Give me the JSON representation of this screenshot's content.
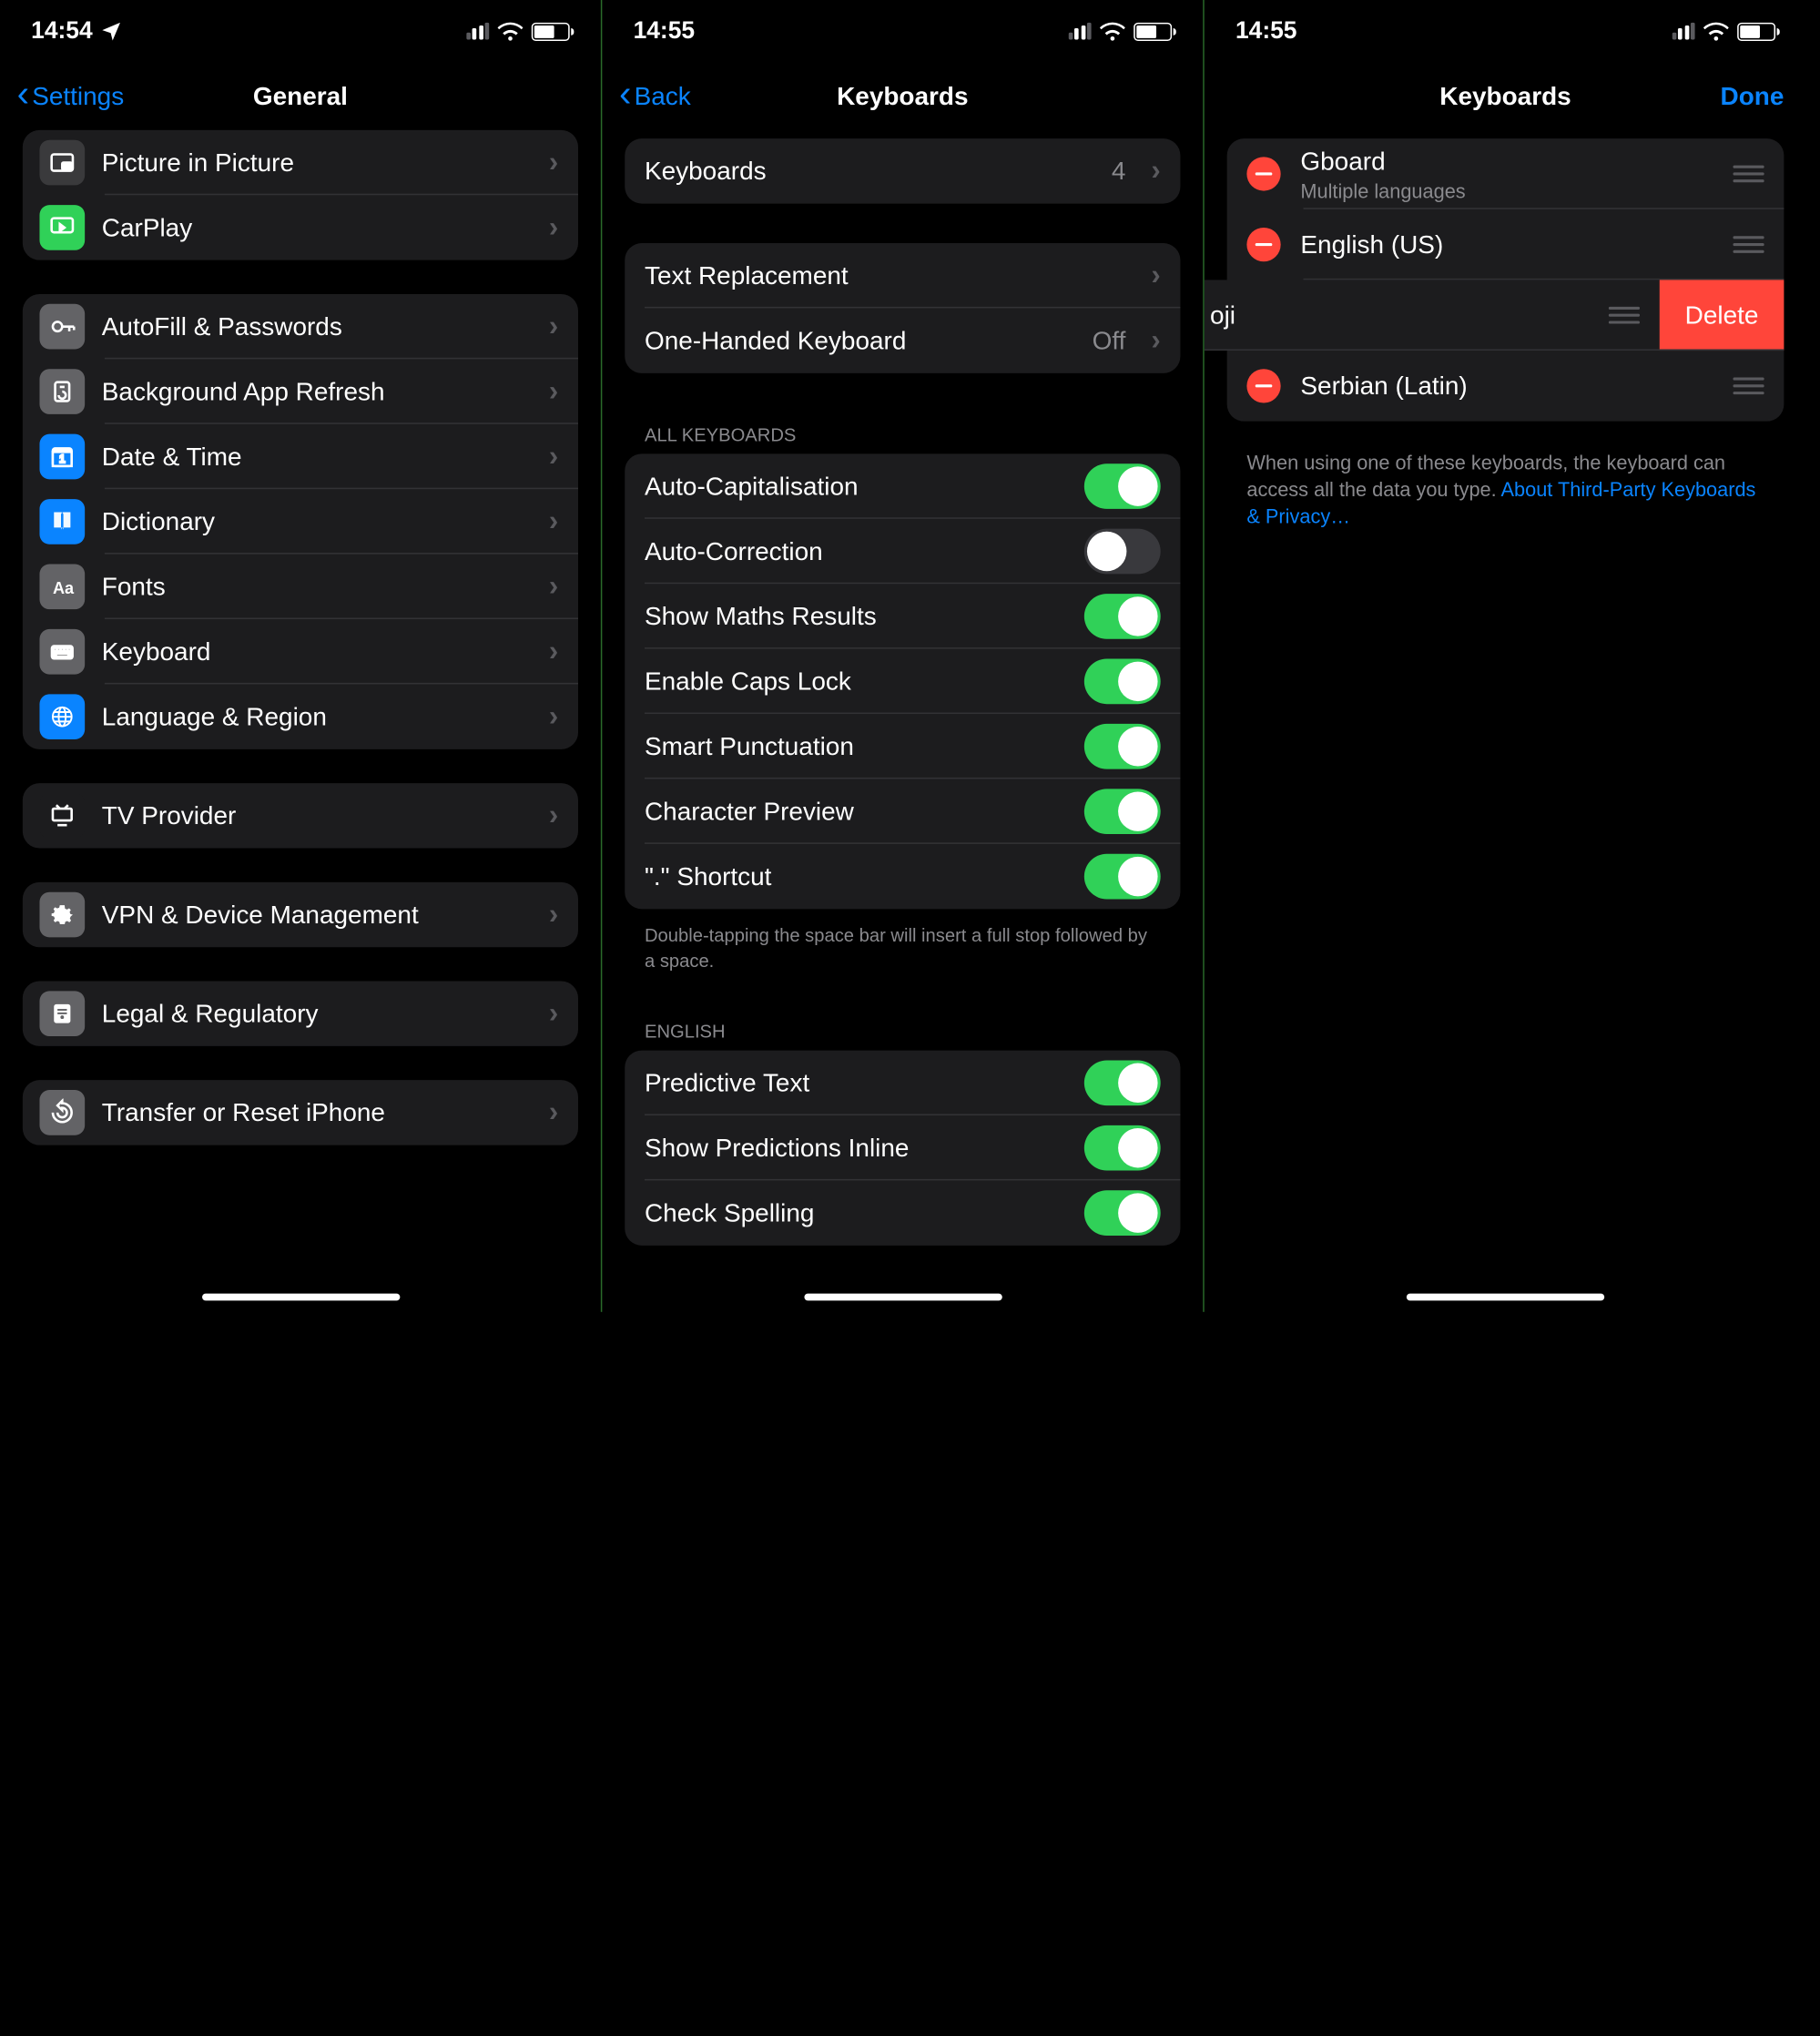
{
  "screen1": {
    "time": "14:54",
    "back": "Settings",
    "title": "General",
    "groups": [
      {
        "items": [
          {
            "id": "pip",
            "icon": "pip",
            "bg": "#3a3a3c",
            "label": "Picture in Picture"
          },
          {
            "id": "carplay",
            "icon": "carplay",
            "bg": "#30d158",
            "label": "CarPlay"
          }
        ]
      },
      {
        "items": [
          {
            "id": "autofill",
            "icon": "key",
            "bg": "#636366",
            "label": "AutoFill & Passwords"
          },
          {
            "id": "refresh",
            "icon": "refresh",
            "bg": "#636366",
            "label": "Background App Refresh"
          },
          {
            "id": "date",
            "icon": "calendar",
            "bg": "#0a84ff",
            "label": "Date & Time"
          },
          {
            "id": "dict",
            "icon": "book",
            "bg": "#0a84ff",
            "label": "Dictionary"
          },
          {
            "id": "fonts",
            "icon": "fonts",
            "bg": "#636366",
            "label": "Fonts"
          },
          {
            "id": "keyboard",
            "icon": "keyboard",
            "bg": "#636366",
            "label": "Keyboard"
          },
          {
            "id": "lang",
            "icon": "globe",
            "bg": "#0a84ff",
            "label": "Language & Region"
          }
        ]
      },
      {
        "items": [
          {
            "id": "tv",
            "icon": "tv",
            "bg": "#1c1c1e",
            "label": "TV Provider"
          }
        ]
      },
      {
        "items": [
          {
            "id": "vpn",
            "icon": "gear",
            "bg": "#636366",
            "label": "VPN & Device Management"
          }
        ]
      },
      {
        "items": [
          {
            "id": "legal",
            "icon": "cert",
            "bg": "#636366",
            "label": "Legal & Regulatory"
          }
        ]
      },
      {
        "items": [
          {
            "id": "transfer",
            "icon": "reset",
            "bg": "#636366",
            "label": "Transfer or Reset iPhone"
          }
        ]
      }
    ]
  },
  "screen2": {
    "time": "14:55",
    "back": "Back",
    "title": "Keyboards",
    "kb_row": {
      "label": "Keyboards",
      "value": "4"
    },
    "text_repl": "Text Replacement",
    "one_hand": {
      "label": "One-Handed Keyboard",
      "value": "Off"
    },
    "all_kb_header": "ALL KEYBOARDS",
    "toggles1": [
      {
        "label": "Auto-Capitalisation",
        "on": true
      },
      {
        "label": "Auto-Correction",
        "on": false
      },
      {
        "label": "Show Maths Results",
        "on": true
      },
      {
        "label": "Enable Caps Lock",
        "on": true
      },
      {
        "label": "Smart Punctuation",
        "on": true
      },
      {
        "label": "Character Preview",
        "on": true
      },
      {
        "label": "\".\" Shortcut",
        "on": true
      }
    ],
    "footer1": "Double-tapping the space bar will insert a full stop followed by a space.",
    "eng_header": "ENGLISH",
    "toggles2": [
      {
        "label": "Predictive Text",
        "on": true
      },
      {
        "label": "Show Predictions Inline",
        "on": true
      },
      {
        "label": "Check Spelling",
        "on": true
      }
    ]
  },
  "screen3": {
    "time": "14:55",
    "title": "Keyboards",
    "done": "Done",
    "rows": [
      {
        "title": "Gboard",
        "sub": "Multiple languages"
      },
      {
        "title": "English (US)"
      },
      {
        "title_fragment": "oji",
        "delete": "Delete"
      },
      {
        "title": "Serbian (Latin)"
      }
    ],
    "footer_text": "When using one of these keyboards, the keyboard can access all the data you type. ",
    "footer_link": "About Third-Party Keyboards & Privacy…"
  }
}
